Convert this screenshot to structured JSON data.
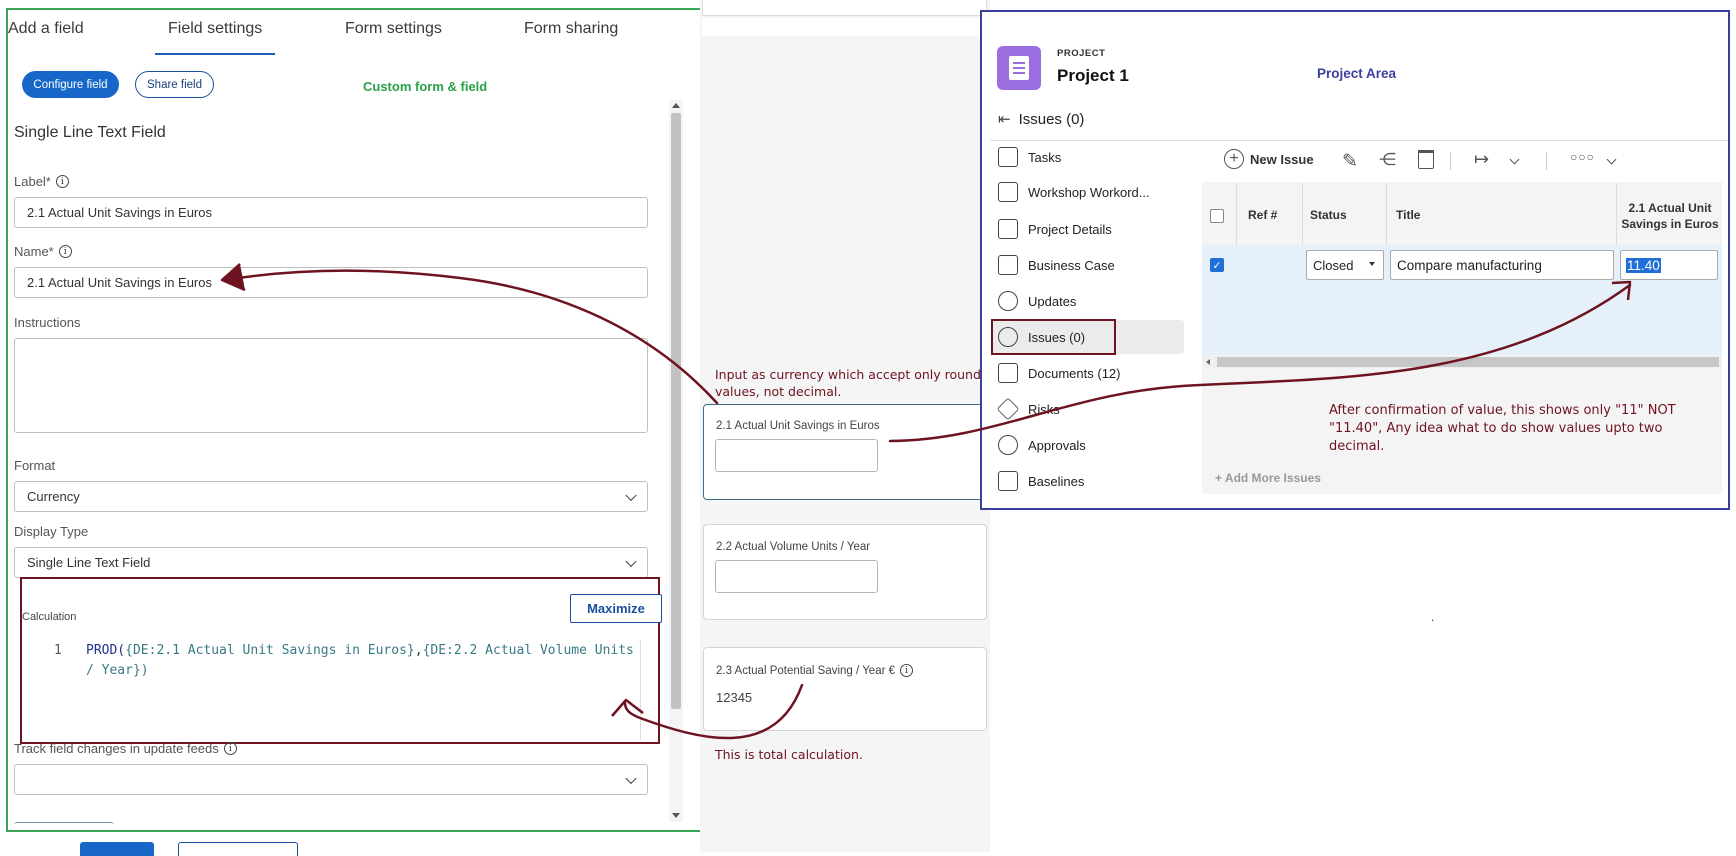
{
  "form_editor": {
    "tabs": [
      "Add a field",
      "Field settings",
      "Form settings",
      "Form sharing"
    ],
    "configure_label": "Configure field",
    "share_label": "Share field",
    "annotation_label": "Custom form & field",
    "field_type_title": "Single Line Text Field",
    "label_label": "Label*",
    "label_value": "2.1 Actual Unit Savings in Euros",
    "name_label": "Name*",
    "name_value": "2.1 Actual Unit Savings in Euros",
    "instructions_label": "Instructions",
    "format_label": "Format",
    "format_value": "Currency",
    "display_type_label": "Display Type",
    "display_type_value": "Single Line Text Field",
    "calculation_label": "Calculation",
    "maximize_label": "Maximize",
    "calc_line_number": "1",
    "calc_func": "PROD(",
    "calc_arg1": "{DE:2.1 Actual Unit Savings in Euros}",
    "calc_comma": ",",
    "calc_arg2": "{DE:2.2 Actual Volume Units",
    "calc_line2": "/ Year})",
    "track_label": "Track field changes in update feeds"
  },
  "preview": {
    "note_currency": "Input as currency which accept only round values, not decimal.",
    "field1_label": "2.1 Actual Unit Savings in Euros",
    "field2_label": "2.2 Actual Volume Units / Year",
    "field3_label": "2.3 Actual Potential Saving / Year €",
    "field3_value": "12345",
    "note_total": "This is total calculation."
  },
  "project": {
    "overline": "PROJECT",
    "name": "Project 1",
    "area_label": "Project Area",
    "header_title": "Issues (0)",
    "nav": [
      {
        "label": "Tasks",
        "icon": "tasks-icon"
      },
      {
        "label": "Workshop Workord...",
        "icon": "workshop-icon"
      },
      {
        "label": "Project Details",
        "icon": "document-icon"
      },
      {
        "label": "Business Case",
        "icon": "business-case-icon"
      },
      {
        "label": "Updates",
        "icon": "updates-icon"
      },
      {
        "label": "Issues (0)",
        "icon": "issues-icon"
      },
      {
        "label": "Documents (12)",
        "icon": "documents-icon"
      },
      {
        "label": "Risks",
        "icon": "risks-icon"
      },
      {
        "label": "Approvals",
        "icon": "approvals-icon"
      },
      {
        "label": "Baselines",
        "icon": "baselines-icon"
      }
    ],
    "new_issue_label": "New Issue",
    "columns": [
      "Ref #",
      "Status",
      "Title",
      "2.1 Actual Unit Savings in Euros"
    ],
    "row": {
      "status": "Closed",
      "title": "Compare manufacturing",
      "value": "11.40"
    },
    "add_more_label": "+ Add More Issues",
    "note_decimal": "After confirmation of value, this shows only \"11\" NOT \"11.40\", Any idea what to do show values upto two decimal.",
    "stray_dot": "."
  },
  "colors": {
    "green_frame": "#3aa655",
    "blue_frame": "#3b3f9e",
    "annotation_red": "#6e1320",
    "primary_blue": "#1667c7"
  }
}
